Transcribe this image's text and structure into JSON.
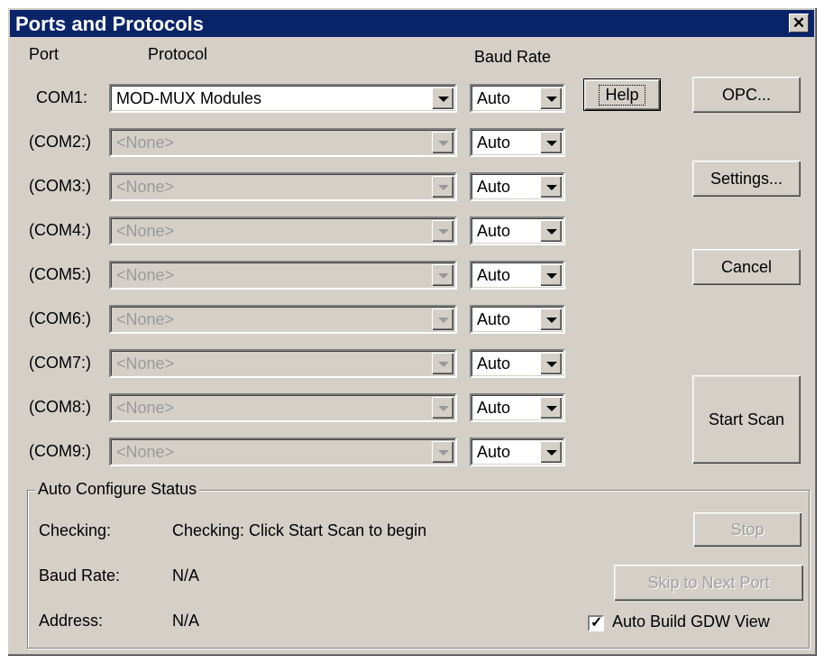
{
  "window": {
    "title": "Ports and Protocols",
    "close_symbol": "✕"
  },
  "headers": {
    "port": "Port",
    "protocol": "Protocol",
    "baud": "Baud Rate"
  },
  "rows": [
    {
      "port": "COM1:",
      "protocol": "MOD-MUX Modules",
      "baud": "Auto",
      "enabled": true
    },
    {
      "port": "(COM2:)",
      "protocol": "<None>",
      "baud": "Auto",
      "enabled": false
    },
    {
      "port": "(COM3:)",
      "protocol": "<None>",
      "baud": "Auto",
      "enabled": false
    },
    {
      "port": "(COM4:)",
      "protocol": "<None>",
      "baud": "Auto",
      "enabled": false
    },
    {
      "port": "(COM5:)",
      "protocol": "<None>",
      "baud": "Auto",
      "enabled": false
    },
    {
      "port": "(COM6:)",
      "protocol": "<None>",
      "baud": "Auto",
      "enabled": false
    },
    {
      "port": "(COM7:)",
      "protocol": "<None>",
      "baud": "Auto",
      "enabled": false
    },
    {
      "port": "(COM8:)",
      "protocol": "<None>",
      "baud": "Auto",
      "enabled": false
    },
    {
      "port": "(COM9:)",
      "protocol": "<None>",
      "baud": "Auto",
      "enabled": false
    }
  ],
  "buttons": {
    "help": "Help",
    "opc": "OPC...",
    "settings": "Settings...",
    "cancel": "Cancel",
    "start_scan": "Start Scan",
    "stop": "Stop",
    "skip": "Skip to Next Port"
  },
  "status": {
    "group_title": "Auto Configure Status",
    "checking_label": "Checking:",
    "checking_value": "Checking: Click Start Scan to begin",
    "baud_label": "Baud Rate:",
    "baud_value": "N/A",
    "address_label": "Address:",
    "address_value": "N/A"
  },
  "auto_build": {
    "label": "Auto Build GDW View",
    "checked": true,
    "check_symbol": "✓"
  },
  "colors": {
    "titlebar": "#0a246a",
    "face": "#d4d0c8"
  }
}
